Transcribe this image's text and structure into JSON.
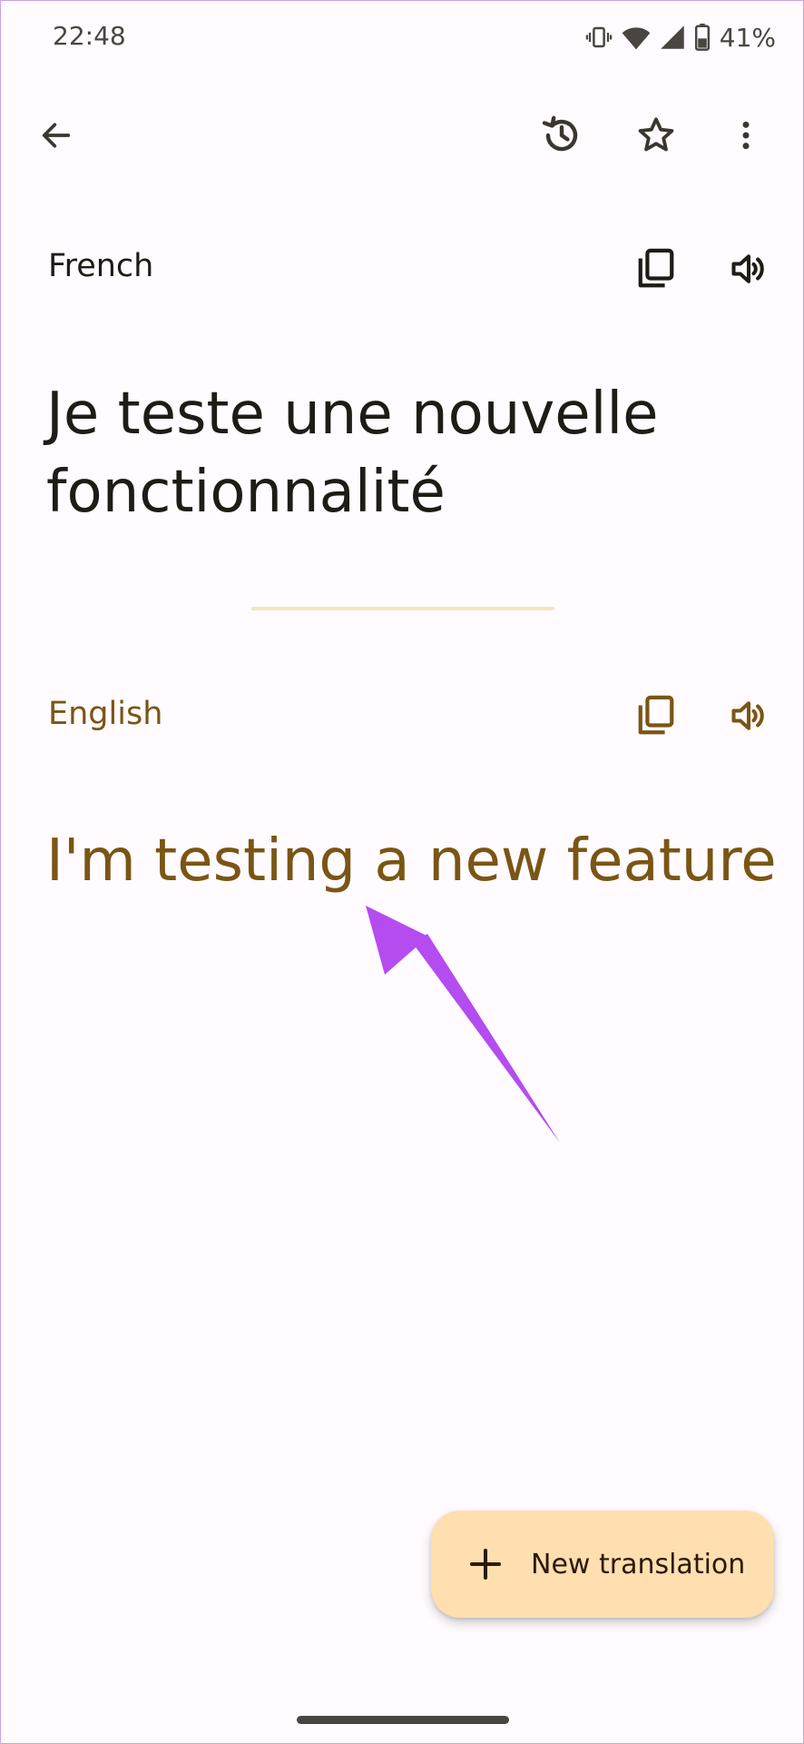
{
  "status_bar": {
    "time": "22:48",
    "battery": "41%",
    "icons": [
      "vibrate-icon",
      "wifi-icon",
      "signal-icon",
      "battery-icon"
    ]
  },
  "app_bar": {
    "icons": [
      "back-arrow-icon",
      "history-icon",
      "star-icon",
      "more-vert-icon"
    ]
  },
  "source": {
    "language": "French",
    "text": "Je teste une nouvelle fonctionnalité",
    "icons": [
      "copy-icon",
      "speaker-icon"
    ]
  },
  "target": {
    "language": "English",
    "text": "I'm testing a new feature",
    "icons": [
      "copy-icon",
      "speaker-icon"
    ]
  },
  "fab": {
    "label": "New translation",
    "icon": "plus-icon"
  },
  "colors": {
    "background": "#fffbfe",
    "text_dark": "#1f1b16",
    "accent_brown": "#7a5514",
    "divider": "#f5e3c0",
    "fab_background": "#ffdeaf",
    "annotation_purple": "#b44cf0"
  }
}
